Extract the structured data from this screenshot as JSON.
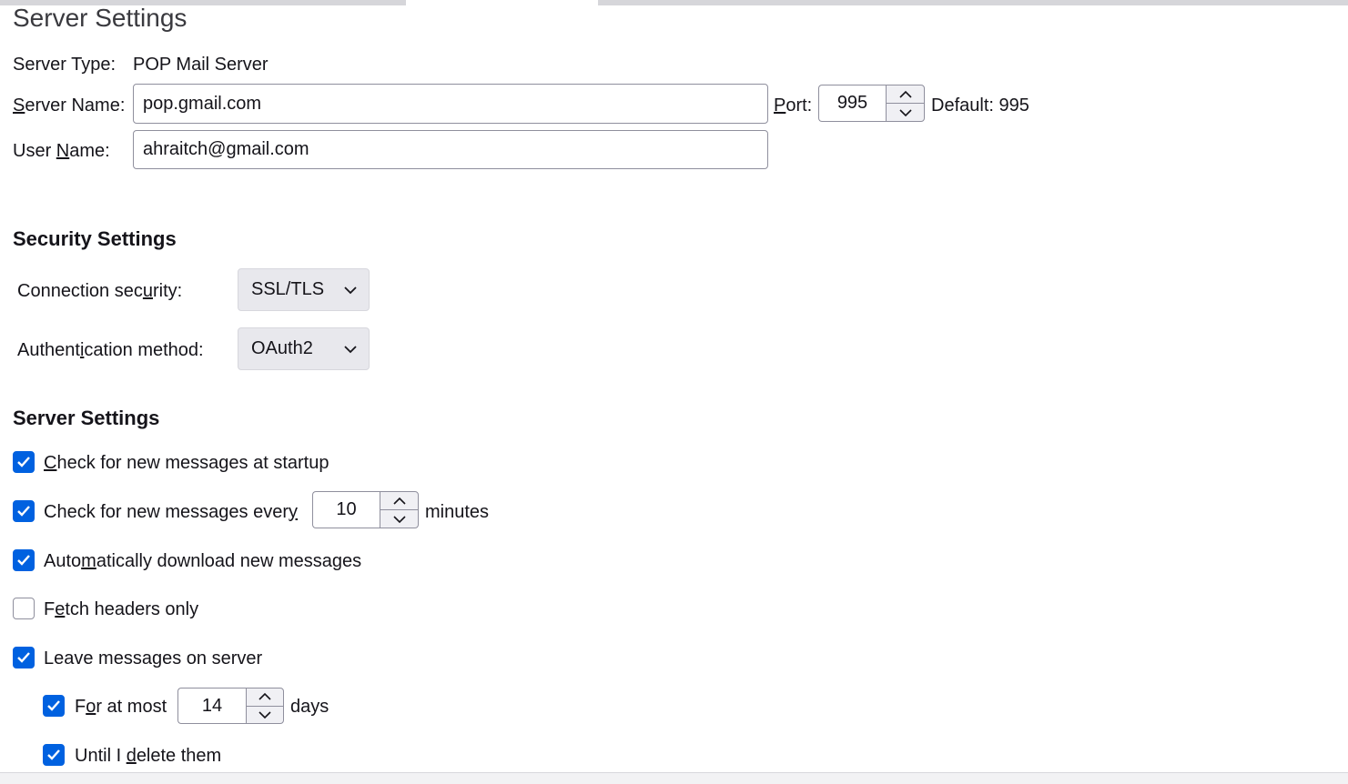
{
  "page": {
    "title": "Server Settings"
  },
  "server": {
    "type_label": "Server Type:",
    "type_value": "POP Mail Server",
    "name_label_pre": "",
    "name_label_ul": "S",
    "name_label_post": "erver Name:",
    "name_value": "pop.gmail.com",
    "port_label_ul": "P",
    "port_label_post": "ort:",
    "port_value": "995",
    "default_text": "Default: 995",
    "user_label_pre": "User ",
    "user_label_ul": "N",
    "user_label_post": "ame:",
    "user_value": "ahraitch@gmail.com"
  },
  "security": {
    "heading": "Security Settings",
    "conn_label_pre": "Connection sec",
    "conn_label_ul": "u",
    "conn_label_post": "rity:",
    "conn_value": "SSL/TLS",
    "auth_label_pre": "Authent",
    "auth_label_ul": "i",
    "auth_label_post": "cation method:",
    "auth_value": "OAuth2"
  },
  "settings": {
    "heading": "Server Settings",
    "startup": {
      "pre": "",
      "ul": "C",
      "post": "heck for new messages at startup",
      "checked": true
    },
    "every": {
      "pre": "Check for new messages ever",
      "ul": "y",
      "post": "",
      "checked": true,
      "value": "10",
      "suffix": "minutes"
    },
    "autodl": {
      "pre": "Auto",
      "ul": "m",
      "post": "atically download new messages",
      "checked": true
    },
    "headers": {
      "pre": "F",
      "ul": "e",
      "post": "tch headers only",
      "checked": false
    },
    "leave": {
      "pre": "Leave messa",
      "ul": "g",
      "post": "es on server",
      "checked": true
    },
    "atmost": {
      "pre": "F",
      "ul": "o",
      "post": "r at most",
      "checked": true,
      "value": "14",
      "suffix": "days"
    },
    "untildel": {
      "pre": "Until I ",
      "ul": "d",
      "post": "elete them",
      "checked": true
    }
  },
  "icons": {
    "checkbox_checked": "checkmark-icon",
    "spin_up": "chevron-up-icon",
    "spin_down": "chevron-down-icon",
    "dropdown": "chevron-down-icon"
  },
  "colors": {
    "accent": "#0061e0",
    "text": "#15141a",
    "border": "#8f8f9d",
    "select_bg": "#e8e8ed"
  }
}
